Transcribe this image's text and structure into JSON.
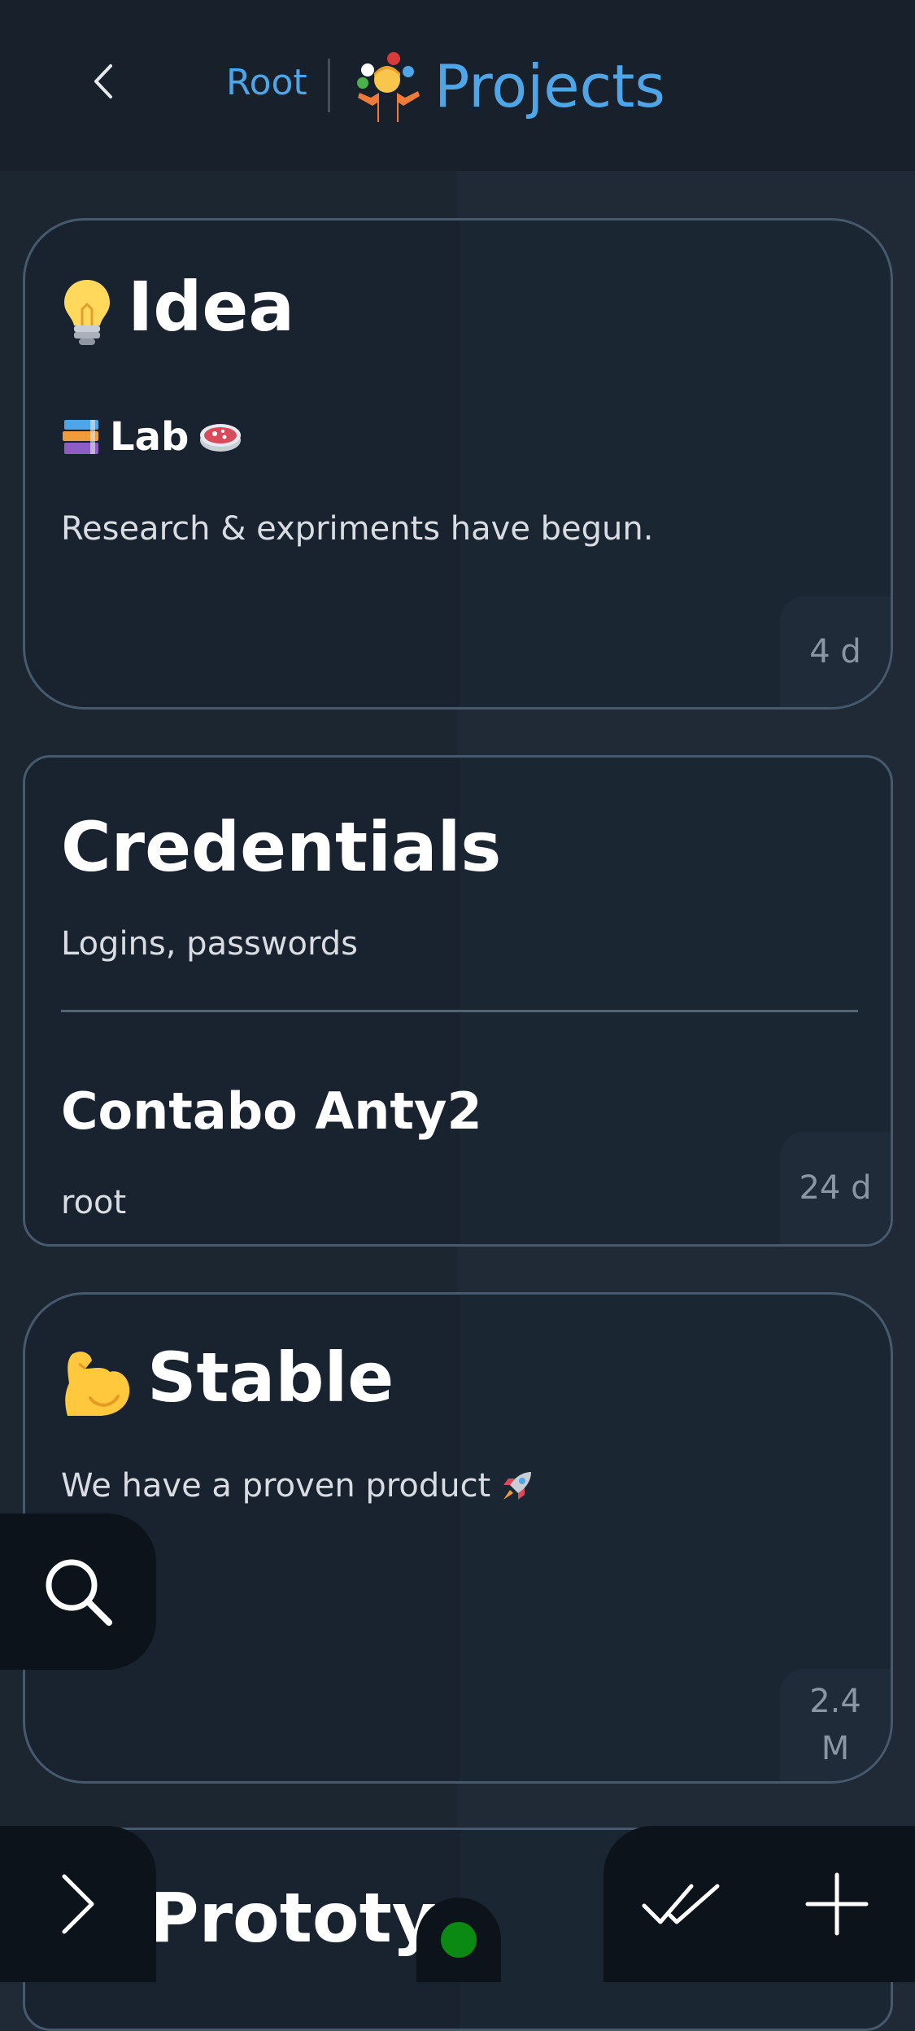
{
  "header": {
    "back_icon": "chevron-left-icon",
    "breadcrumb_root": "Root",
    "title_icon": "person-juggling-emoji",
    "title": "Projects"
  },
  "cards": [
    {
      "title_icon": "light-bulb-emoji",
      "title": "Idea",
      "subtitle_icon_left": "books-emoji",
      "subtitle": "Lab",
      "subtitle_icon_right": "petri-dish-emoji",
      "text": "Research & expriments have begun.",
      "age": "4 d"
    },
    {
      "title": "Credentials",
      "text": "Logins, passwords",
      "subtitle": "Contabo Anty2",
      "text2": "root",
      "age": "24 d"
    },
    {
      "title_icon": "flexed-biceps-emoji",
      "title": "Stable",
      "text": "We have a proven product",
      "text_icon": "rocket-emoji",
      "age_line1": "2.4",
      "age_line2": "M"
    },
    {
      "title": "Prototyp"
    }
  ],
  "toolbar": {
    "search_icon": "search-icon",
    "expand_icon": "chevron-right-icon",
    "mark_all_icon": "double-check-icon",
    "add_icon": "plus-icon",
    "status_color": "#0a8a12"
  },
  "colors": {
    "accent": "#4ea6e8",
    "background": "#1f2a36",
    "card": "#1b2633",
    "card_border": "#46596d"
  }
}
